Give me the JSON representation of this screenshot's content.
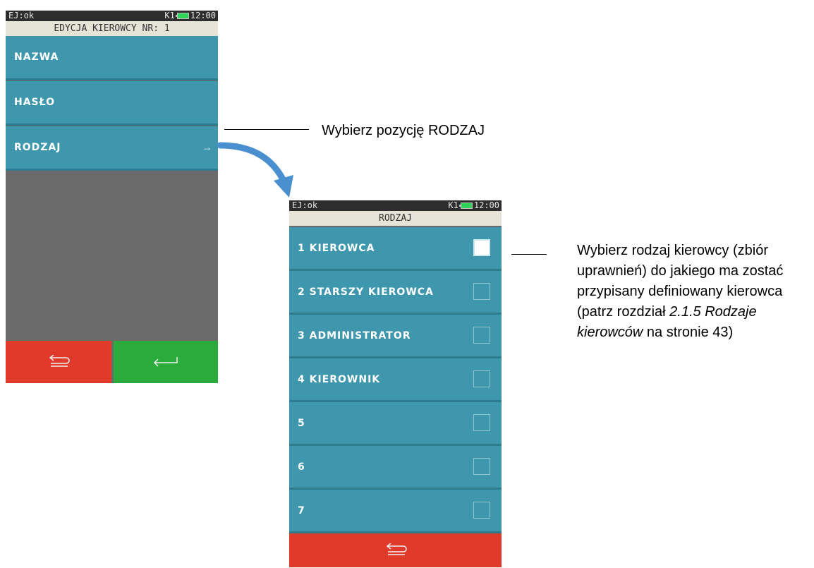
{
  "screen1": {
    "status": {
      "left": "EJ:ok",
      "right_prefix": "K1",
      "time": "12:00"
    },
    "title": "EDYCJA KIEROWCY NR: 1",
    "items": [
      {
        "label": "NAZWA"
      },
      {
        "label": "HASŁO"
      },
      {
        "label": "RODZAJ"
      }
    ]
  },
  "screen2": {
    "status": {
      "left": "EJ:ok",
      "right_prefix": "K1",
      "time": "12:00"
    },
    "title": "RODZAJ",
    "items": [
      {
        "label": "1 KIEROWCA",
        "checked": true
      },
      {
        "label": "2 STARSZY KIEROWCA",
        "checked": false
      },
      {
        "label": "3 ADMINISTRATOR",
        "checked": false
      },
      {
        "label": "4 KIEROWNIK",
        "checked": false
      },
      {
        "label": "5",
        "checked": false
      },
      {
        "label": "6",
        "checked": false
      },
      {
        "label": "7",
        "checked": false
      }
    ]
  },
  "annotations": {
    "first": "Wybierz pozycję RODZAJ",
    "second": {
      "line1": "Wybierz rodzaj kierowcy (zbiór",
      "line2": "uprawnień) do jakiego ma zostać",
      "line3": "przypisany definiowany kierowca",
      "line4_a": "(patrz rozdział ",
      "line4_b": "2.1.5 Rodzaje",
      "line5_a": "kierowców",
      "line5_b": " na stronie 43)"
    }
  },
  "colors": {
    "menu_teal": "#3f97ad",
    "title_bg": "#e6e3d7",
    "back_red": "#e03a2b",
    "enter_green": "#2aab3b",
    "arrow_blue": "#4a8fcf"
  }
}
